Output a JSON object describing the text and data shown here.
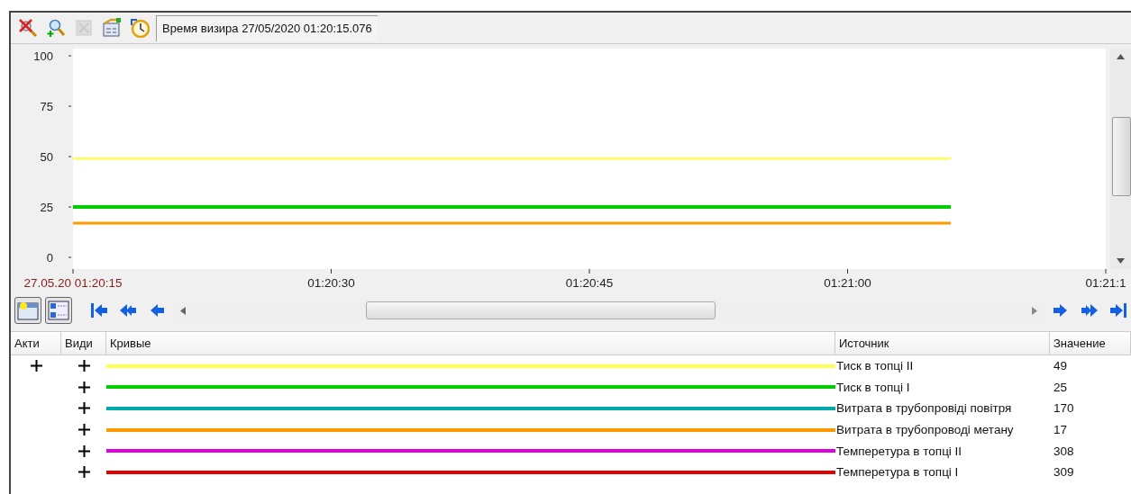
{
  "toolbar": {
    "buttons": [
      {
        "kind": "delete-zoom",
        "disabled": false
      },
      {
        "kind": "zoom-in",
        "disabled": false
      },
      {
        "kind": "blank",
        "disabled": true
      },
      {
        "kind": "table",
        "disabled": false
      },
      {
        "kind": "clock",
        "disabled": false
      }
    ],
    "cursor_time": "Время визира 27/05/2020 01:20:15.076"
  },
  "chart": {
    "chart_data": {
      "type": "line",
      "x": [
        4815,
        4866
      ],
      "xlim": [
        4815,
        4875
      ],
      "ylim": [
        -5.8,
        103.6
      ],
      "yticks": [
        0,
        25,
        50,
        75,
        100
      ],
      "xticks": [
        {
          "value": 4815,
          "label": "27.05.20 01:20:15"
        },
        {
          "value": 4830,
          "label": "01:20:30"
        },
        {
          "value": 4845,
          "label": "01:20:45"
        },
        {
          "value": 4860,
          "label": "01:21:00"
        },
        {
          "value": 4875,
          "label": "01:21:1"
        }
      ],
      "series": [
        {
          "color": "#ffff50",
          "values": [
            49,
            49
          ]
        },
        {
          "color": "#00cc00",
          "values": [
            25,
            25
          ]
        },
        {
          "color": "#ff9900",
          "values": [
            17,
            17
          ]
        }
      ]
    }
  },
  "table": {
    "columns": [
      "Акти",
      "Види",
      "Кривые",
      "Источник",
      "Значение"
    ],
    "rows": [
      {
        "active": true,
        "visible": true,
        "color": "#ffff50",
        "source": "Тиск в топці II",
        "value": "49"
      },
      {
        "active": false,
        "visible": true,
        "color": "#00cc00",
        "source": "Тиск в топці I",
        "value": "25"
      },
      {
        "active": false,
        "visible": true,
        "color": "#00aaaa",
        "source": "Витрата в трубопровіді повітря",
        "value": "170"
      },
      {
        "active": false,
        "visible": true,
        "color": "#ff9900",
        "source": "Витрата в трубопроводі метану",
        "value": "17"
      },
      {
        "active": false,
        "visible": true,
        "color": "#e000e0",
        "source": "Темперетура в топці II",
        "value": "308"
      },
      {
        "active": false,
        "visible": true,
        "color": "#e00000",
        "source": "Темперетура в топці I",
        "value": "309"
      }
    ]
  }
}
